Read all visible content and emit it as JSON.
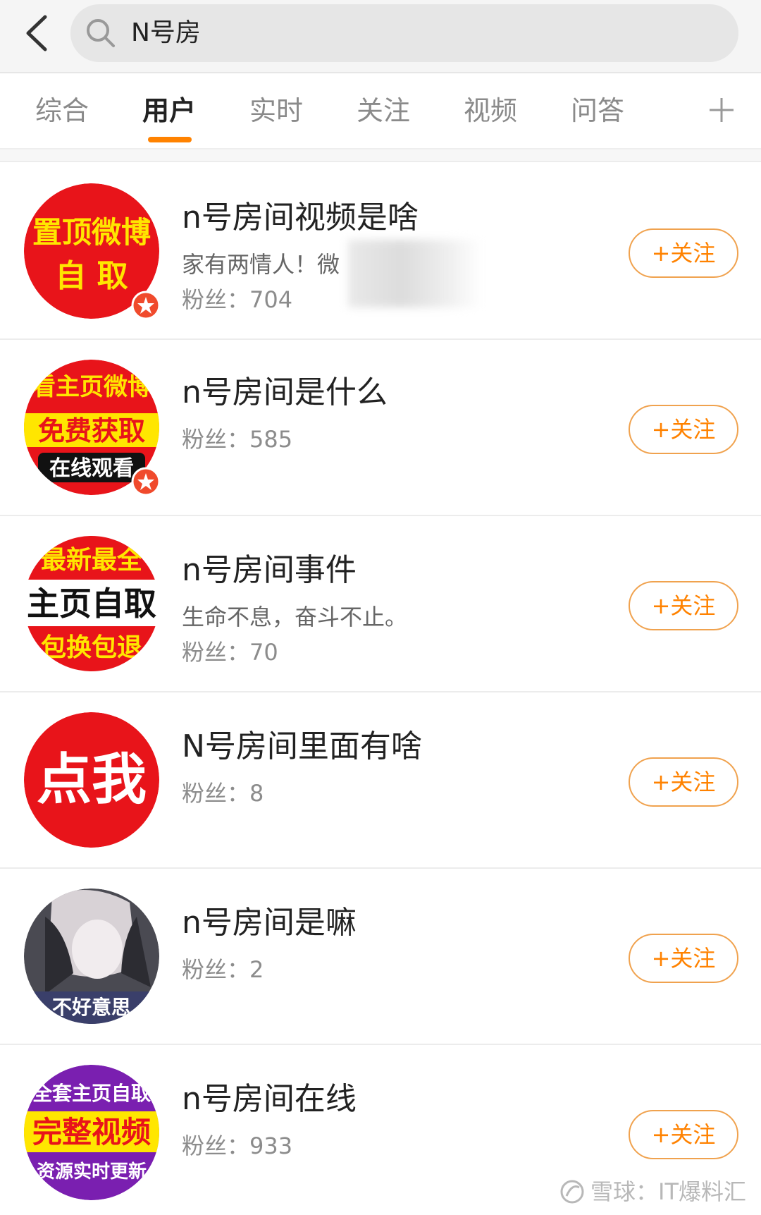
{
  "search": {
    "query": "N号房"
  },
  "tabs": [
    {
      "label": "综合"
    },
    {
      "label": "用户",
      "active": true
    },
    {
      "label": "实时"
    },
    {
      "label": "关注"
    },
    {
      "label": "视频"
    },
    {
      "label": "问答"
    }
  ],
  "accent_color": "#ff8200",
  "users": [
    {
      "name": "n号房间视频是啥",
      "description": "家有两情人！微",
      "fans": "粉丝：704",
      "follow_label": "+关注",
      "avatar": {
        "lines": [
          "置顶微博",
          "自 取"
        ]
      }
    },
    {
      "name": "n号房间是什么",
      "fans": "粉丝：585",
      "follow_label": "+关注",
      "avatar": {
        "lines": [
          "看主页微博",
          "免费获取",
          "在线观看"
        ]
      }
    },
    {
      "name": "n号房间事件",
      "description": "生命不息，奋斗不止。",
      "fans": "粉丝：70",
      "follow_label": "+关注",
      "avatar": {
        "lines": [
          "最新最全",
          "主页自取",
          "包换包退"
        ]
      }
    },
    {
      "name": "N号房间里面有啥",
      "fans": "粉丝：8",
      "follow_label": "+关注",
      "avatar": {
        "lines": [
          "点我"
        ]
      }
    },
    {
      "name": "n号房间是嘛",
      "fans": "粉丝：2",
      "follow_label": "+关注",
      "avatar": {
        "lines": [
          "不好意思"
        ]
      }
    },
    {
      "name": "n号房间在线",
      "fans": "粉丝：933",
      "follow_label": "+关注",
      "avatar": {
        "lines": [
          "全套主页自取",
          "完整视频",
          "资源实时更新"
        ]
      }
    }
  ],
  "watermark": "雪球：IT爆料汇"
}
